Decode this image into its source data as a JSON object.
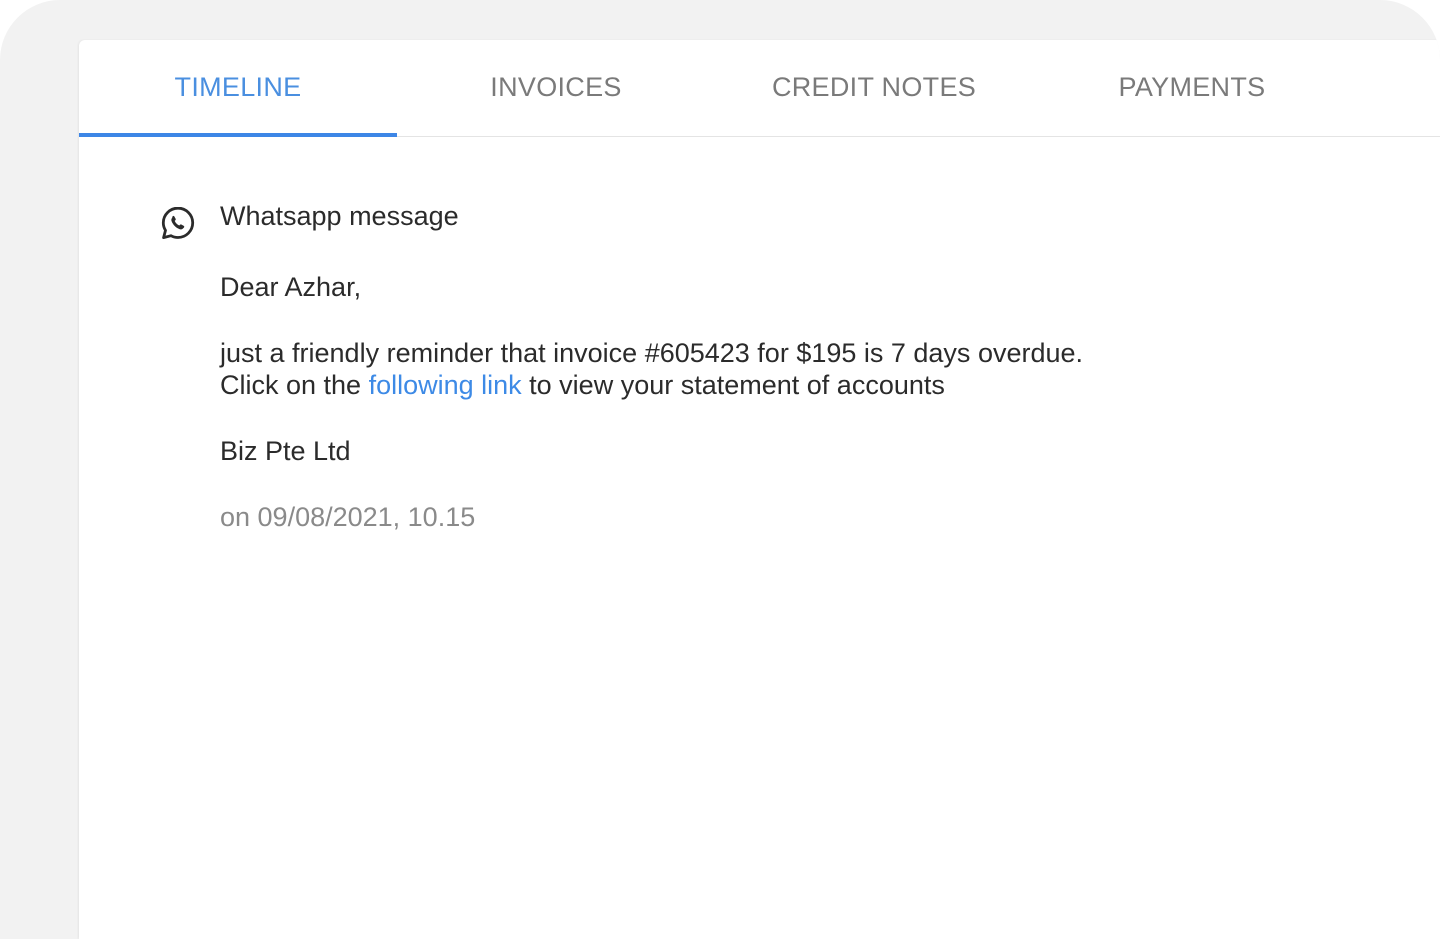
{
  "tabs": [
    {
      "label": "TIMELINE",
      "active": true
    },
    {
      "label": "INVOICES",
      "active": false
    },
    {
      "label": "CREDIT NOTES",
      "active": false
    },
    {
      "label": "PAYMENTS",
      "active": false
    }
  ],
  "timeline": {
    "entry": {
      "icon": "whatsapp-icon",
      "title": "Whatsapp message",
      "greeting": "Dear Azhar,",
      "line1": "just a friendly reminder that invoice #605423 for $195 is 7 days overdue.",
      "line2_prefix": "Click on the ",
      "line2_link": "following link",
      "line2_suffix": " to view your statement of accounts",
      "signoff": "Biz Pte Ltd",
      "timestamp": "on 09/08/2021, 10.15"
    }
  },
  "colors": {
    "accent": "#3d86e6",
    "link": "#3d8ae6",
    "tab_inactive": "#7a7a7a",
    "text": "#2b2b2b",
    "muted": "#8a8a8a"
  }
}
